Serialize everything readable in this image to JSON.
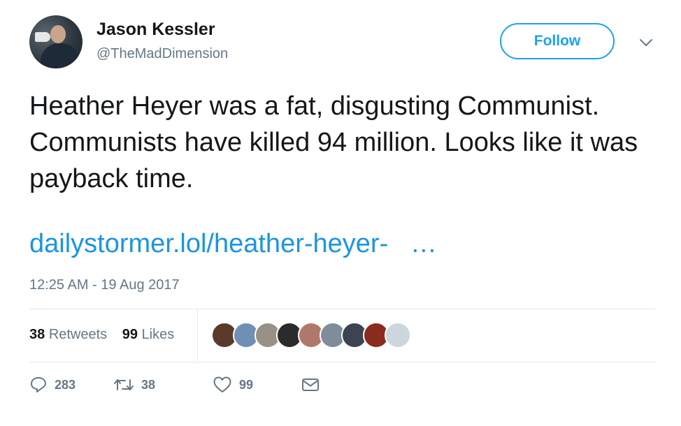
{
  "author": {
    "name": "Jason Kessler",
    "handle": "@TheMadDimension"
  },
  "follow_label": "Follow",
  "tweet": {
    "text": "Heather Heyer was a fat, disgusting Communist. Communists have killed 94 million. Looks like it was payback time.",
    "link": "dailystormer.lol/heather-heyer-   …",
    "timestamp": "12:25 AM - 19 Aug 2017"
  },
  "stats": {
    "retweets_count": "38",
    "retweets_label": "Retweets",
    "likes_count": "99",
    "likes_label": "Likes"
  },
  "liker_avatars": [
    {
      "color": "#5a3a2a"
    },
    {
      "color": "#6f8fb5"
    },
    {
      "color": "#9a9186"
    },
    {
      "color": "#2b2b2b"
    },
    {
      "color": "#b0786a"
    },
    {
      "color": "#7f8d99"
    },
    {
      "color": "#3b4450"
    },
    {
      "color": "#8a2b1e"
    },
    {
      "color": "#ccd6dd"
    }
  ],
  "actions": {
    "reply_count": "283",
    "retweet_count": "38",
    "like_count": "99"
  },
  "colors": {
    "accent": "#1da1f2",
    "link": "#1b95e0",
    "secondary_text": "#657786"
  }
}
